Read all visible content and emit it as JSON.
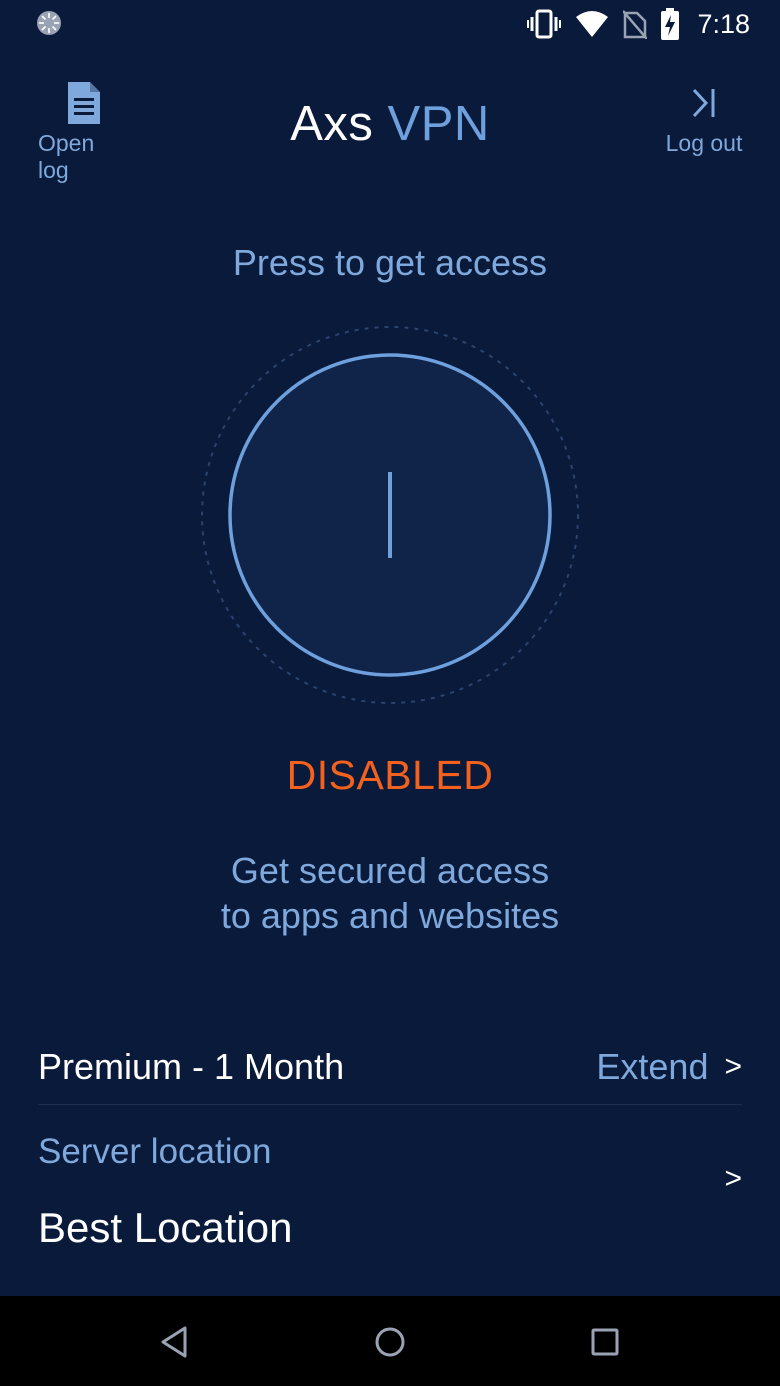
{
  "status_bar": {
    "time": "7:18",
    "icons": [
      "sync-icon",
      "vibrate-icon",
      "wifi-icon",
      "no-sim-icon",
      "battery-charging-icon"
    ]
  },
  "header": {
    "title_part1": "Axs",
    "title_part2": "VPN",
    "open_log_label": "Open log",
    "open_log_icon": "document-icon",
    "log_out_label": "Log out",
    "log_out_icon": "logout-arrow-icon"
  },
  "main": {
    "prompt": "Press to get access",
    "power_icon": "power-icon",
    "status": "DISABLED",
    "description_line1": "Get secured access",
    "description_line2": "to apps and websites"
  },
  "plan": {
    "name": "Premium - 1 Month",
    "extend_label": "Extend",
    "chevron": ">"
  },
  "server": {
    "title": "Server location",
    "value": "Best Location",
    "chevron": ">"
  },
  "nav": {
    "buttons": [
      "back-icon",
      "home-icon",
      "recents-icon"
    ]
  },
  "colors": {
    "background": "#0a1a3a",
    "accent": "#7fa9dc",
    "status_disabled": "#f2611e",
    "ring": "#6ea0de"
  }
}
